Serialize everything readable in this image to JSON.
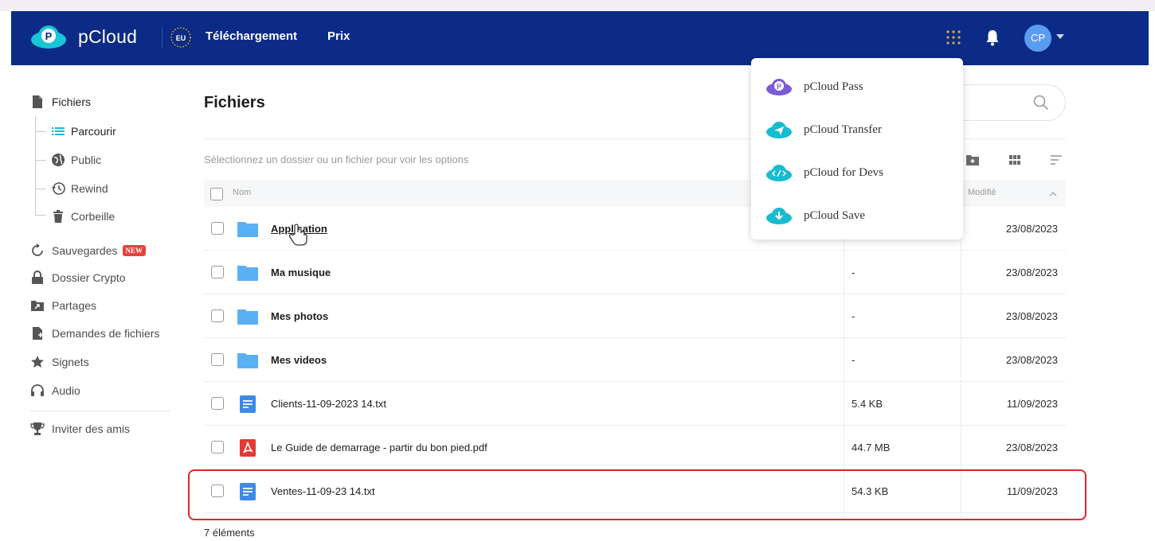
{
  "header": {
    "brand": "pCloud",
    "region": "EU",
    "nav": [
      "Téléchargement",
      "Prix"
    ],
    "avatar_initials": "CP",
    "bar_color": "#0b2b86"
  },
  "sidebar": {
    "items": [
      {
        "label": "Fichiers",
        "icon": "file-icon"
      },
      {
        "label": "Sauvegardes",
        "icon": "backup-icon",
        "badge": "NEW"
      },
      {
        "label": "Dossier Crypto",
        "icon": "lock-icon"
      },
      {
        "label": "Partages",
        "icon": "share-icon"
      },
      {
        "label": "Demandes de fichiers",
        "icon": "file-request-icon"
      },
      {
        "label": "Signets",
        "icon": "star-icon"
      },
      {
        "label": "Audio",
        "icon": "headphones-icon"
      },
      {
        "label": "Inviter des amis",
        "icon": "trophy-icon"
      }
    ],
    "subitems": [
      {
        "label": "Parcourir",
        "icon": "list-icon"
      },
      {
        "label": "Public",
        "icon": "globe-icon"
      },
      {
        "label": "Rewind",
        "icon": "history-icon"
      },
      {
        "label": "Corbeille",
        "icon": "trash-icon"
      }
    ]
  },
  "main": {
    "title": "Fichiers",
    "hint": "Sélectionnez un dossier ou un fichier pour voir les options",
    "columns": {
      "name": "Nom",
      "modified": "Modifié"
    },
    "rows": [
      {
        "name": "Application",
        "type": "folder",
        "size": "",
        "date": "23/08/2023"
      },
      {
        "name": "Ma musique",
        "type": "folder",
        "size": "-",
        "date": "23/08/2023"
      },
      {
        "name": "Mes photos",
        "type": "folder",
        "size": "-",
        "date": "23/08/2023"
      },
      {
        "name": "Mes videos",
        "type": "folder",
        "size": "-",
        "date": "23/08/2023"
      },
      {
        "name": "Clients-11-09-2023 14.txt",
        "type": "text",
        "size": "5.4 KB",
        "date": "11/09/2023"
      },
      {
        "name": "Le Guide de demarrage - partir du bon pied.pdf",
        "type": "pdf",
        "size": "44.7 MB",
        "date": "23/08/2023"
      },
      {
        "name": "Ventes-11-09-23 14.txt",
        "type": "text",
        "size": "54.3 KB",
        "date": "11/09/2023"
      }
    ],
    "count": "7 éléments",
    "highlight_color": "#e0262b"
  },
  "apps_menu": {
    "items": [
      {
        "label": "pCloud Pass",
        "icon": "pass-icon"
      },
      {
        "label": "pCloud Transfer",
        "icon": "transfer-icon"
      },
      {
        "label": "pCloud for Devs",
        "icon": "devs-icon"
      },
      {
        "label": "pCloud Save",
        "icon": "save-icon"
      }
    ]
  }
}
